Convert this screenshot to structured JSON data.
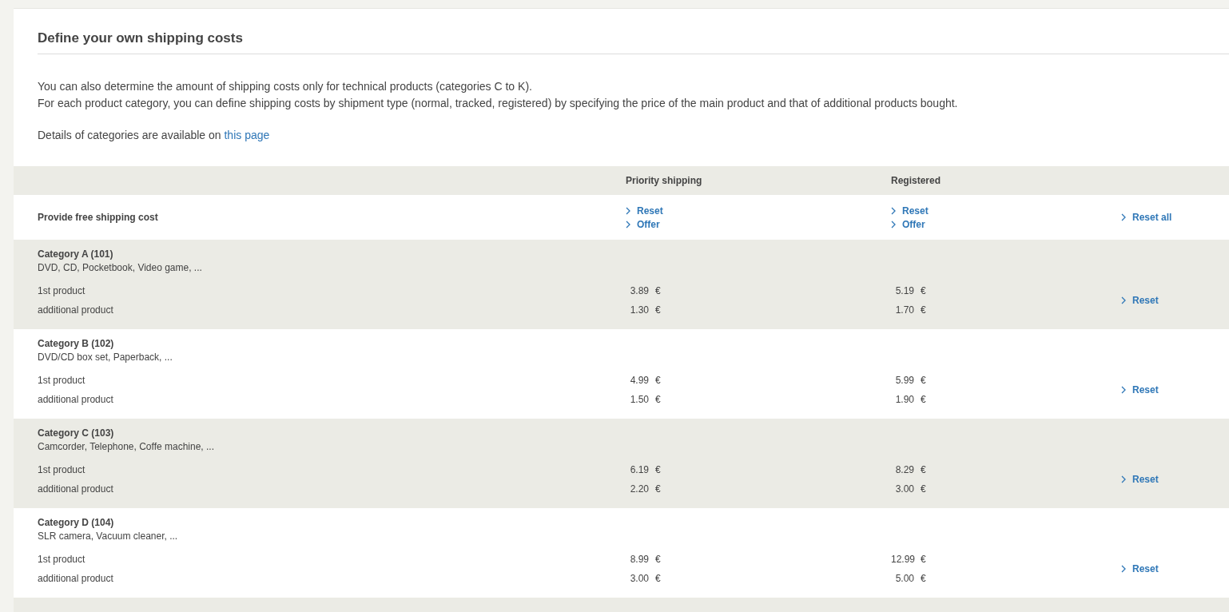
{
  "title": "Define your own shipping costs",
  "intro_lines": [
    "You can also determine the amount of shipping costs only for technical products (categories C to K).",
    "For each product category, you can define shipping costs by shipment type (normal, tracked, registered) by specifying the price of the main product and that of additional products bought."
  ],
  "details": {
    "text": "Details of categories are available on",
    "link": "this page"
  },
  "columns": [
    "Priority shipping",
    "Registered"
  ],
  "free_shipping": {
    "label": "Provide free shipping cost",
    "actions": [
      [
        "Reset",
        "Offer"
      ],
      [
        "Reset",
        "Offer"
      ]
    ],
    "reset_all": "Reset all"
  },
  "categories": [
    {
      "title": "Category A (101)",
      "description": "DVD, CD, Pocketbook, Video game, ...",
      "rows": [
        {
          "label": "1st product",
          "values": [
            "3.89",
            "5.19"
          ]
        },
        {
          "label": "additional product",
          "values": [
            "1.30",
            "1.70"
          ]
        }
      ],
      "currency": "€",
      "reset": "Reset"
    },
    {
      "title": "Category B (102)",
      "description": "DVD/CD box set, Paperback, ...",
      "rows": [
        {
          "label": "1st product",
          "values": [
            "4.99",
            "5.99"
          ]
        },
        {
          "label": "additional product",
          "values": [
            "1.50",
            "1.90"
          ]
        }
      ],
      "currency": "€",
      "reset": "Reset"
    },
    {
      "title": "Category C (103)",
      "description": "Camcorder, Telephone, Coffe machine, ...",
      "rows": [
        {
          "label": "1st product",
          "values": [
            "6.19",
            "8.29"
          ]
        },
        {
          "label": "additional product",
          "values": [
            "2.20",
            "3.00"
          ]
        }
      ],
      "currency": "€",
      "reset": "Reset"
    },
    {
      "title": "Category D (104)",
      "description": "SLR camera, Vacuum cleaner, ...",
      "rows": [
        {
          "label": "1st product",
          "values": [
            "8.99",
            "12.99"
          ]
        },
        {
          "label": "additional product",
          "values": [
            "3.00",
            "5.00"
          ]
        }
      ],
      "currency": "€",
      "reset": "Reset"
    }
  ]
}
